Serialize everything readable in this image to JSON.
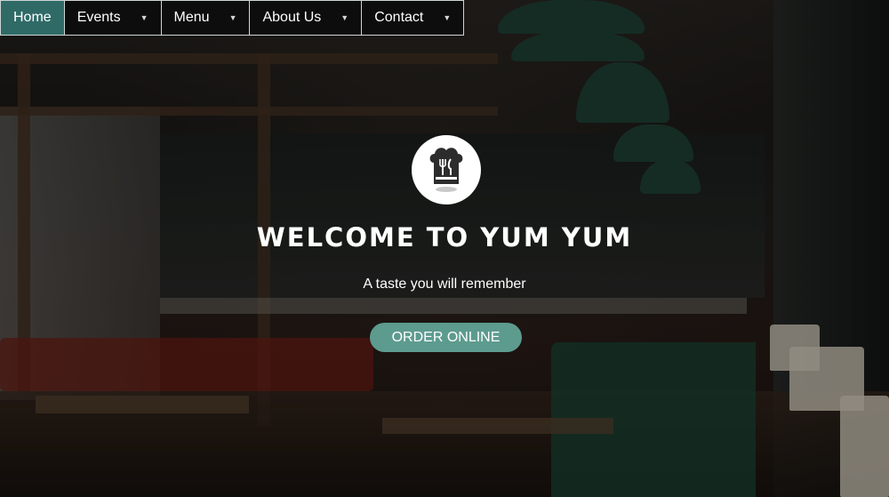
{
  "nav": {
    "items": [
      {
        "label": "Home",
        "has_dropdown": false,
        "active": true
      },
      {
        "label": "Events",
        "has_dropdown": true,
        "active": false
      },
      {
        "label": "Menu",
        "has_dropdown": true,
        "active": false
      },
      {
        "label": "About Us",
        "has_dropdown": true,
        "active": false
      },
      {
        "label": "Contact",
        "has_dropdown": true,
        "active": false
      }
    ]
  },
  "hero": {
    "logo_icon": "chef-hat-utensils-icon",
    "title": "WELCOME TO YUM YUM",
    "subtitle": "A taste you will remember",
    "cta_label": "ORDER ONLINE"
  },
  "colors": {
    "accent": "#2f6a67",
    "button": "#5d9b8f",
    "nav_bg": "#0d0d0d"
  }
}
